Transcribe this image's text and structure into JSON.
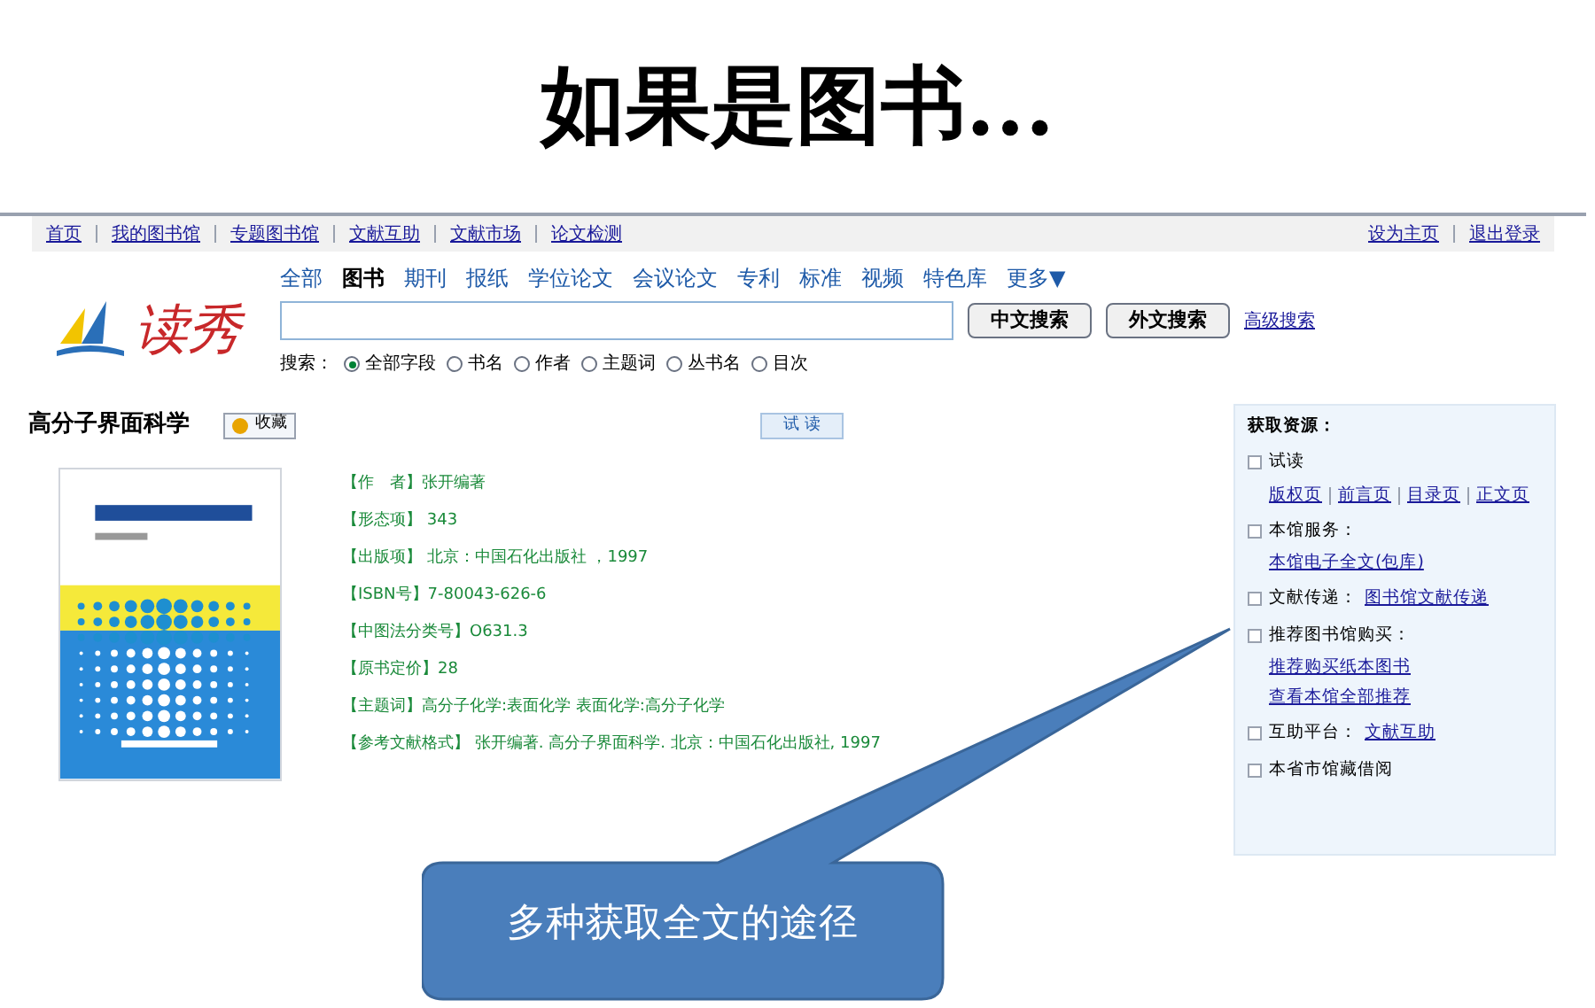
{
  "slide_title": "如果是图书...",
  "top_links": [
    "首页",
    "我的图书馆",
    "专题图书馆",
    "文献互助",
    "文献市场",
    "论文检测"
  ],
  "right_links": [
    "设为主页",
    "退出登录"
  ],
  "categories": [
    {
      "label": "全部",
      "selected": false
    },
    {
      "label": "图书",
      "selected": true
    },
    {
      "label": "期刊",
      "selected": false
    },
    {
      "label": "报纸",
      "selected": false
    },
    {
      "label": "学位论文",
      "selected": false
    },
    {
      "label": "会议论文",
      "selected": false
    },
    {
      "label": "专利",
      "selected": false
    },
    {
      "label": "标准",
      "selected": false
    },
    {
      "label": "视频",
      "selected": false
    },
    {
      "label": "特色库",
      "selected": false
    },
    {
      "label": "更多▼",
      "selected": false
    }
  ],
  "logo_text": "读秀",
  "search": {
    "buttons": [
      "中文搜索",
      "外文搜索"
    ],
    "advanced": "高级搜索",
    "scope_label": "搜索：",
    "options": [
      {
        "label": "全部字段",
        "selected": true
      },
      {
        "label": "书名",
        "selected": false
      },
      {
        "label": "作者",
        "selected": false
      },
      {
        "label": "主题词",
        "selected": false
      },
      {
        "label": "丛书名",
        "selected": false
      },
      {
        "label": "目次",
        "selected": false
      }
    ]
  },
  "book": {
    "title": "高分子界面科学",
    "collect": "收藏",
    "trial": "试 读",
    "details": [
      "【作　者】张开编著",
      "【形态项】 343",
      "【出版项】 北京：中国石化出版社 ，1997",
      "【ISBN号】7-80043-626-6",
      "【中图法分类号】O631.3",
      "【原书定价】28",
      "【主题词】高分子化学:表面化学 表面化学:高分子化学",
      "【参考文献格式】 张开编著. 高分子界面科学. 北京：中国石化出版社, 1997"
    ]
  },
  "sources": {
    "title": "获取资源：",
    "items": [
      {
        "label": "试读",
        "links": [
          "版权页",
          "前言页",
          "目录页",
          "正文页"
        ]
      },
      {
        "label": "本馆服务：",
        "links": [
          "本馆电子全文(包库)"
        ]
      },
      {
        "label": "文献传递：",
        "inline_link": "图书馆文献传递"
      },
      {
        "label": "推荐图书馆购买：",
        "links": [
          "推荐购买纸本图书",
          "查看本馆全部推荐"
        ]
      },
      {
        "label": "互助平台：",
        "inline_link": "文献互助"
      },
      {
        "label": "本省市馆藏借阅"
      }
    ]
  },
  "callout": "多种获取全文的途径"
}
